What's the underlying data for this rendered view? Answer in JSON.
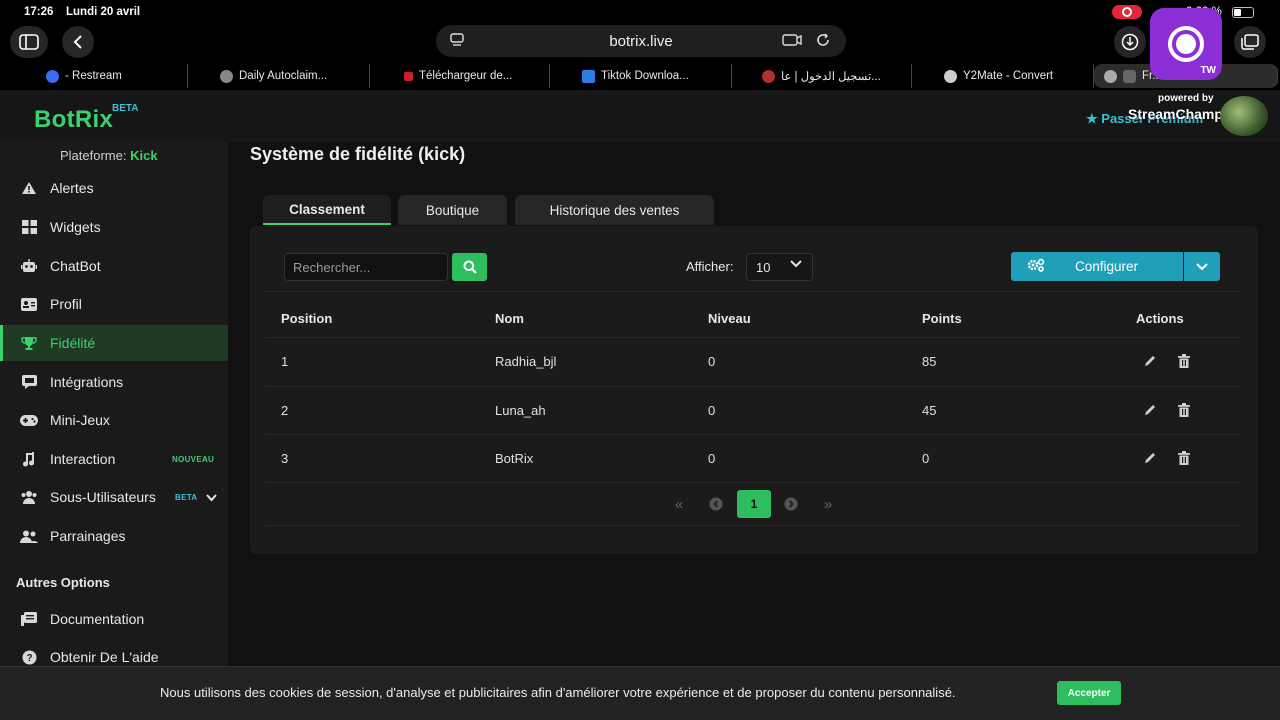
{
  "status": {
    "time": "17:26",
    "date": "Lundi 20 avril",
    "battery": "0 00 %"
  },
  "browser": {
    "url": "botrix.live",
    "tabs": [
      {
        "label": "- Restream",
        "color": "#3b6cf0"
      },
      {
        "label": "Daily Autoclaim...",
        "color": "#888888"
      },
      {
        "label": "Téléchargeur de...",
        "color": "#d01c2c"
      },
      {
        "label": "Tiktok Downloa...",
        "color": "#2a7de1"
      },
      {
        "label": "تسجيل الدخول | عا...",
        "color": "#b03030"
      },
      {
        "label": "Y2Mate - Convert",
        "color": "#cccccc"
      },
      {
        "label": "Fr... ...eil...",
        "color": "#aaaaaa"
      }
    ]
  },
  "overlay": {
    "tag": "TW",
    "powered": "powered by",
    "name": "StreamChamp.app"
  },
  "header": {
    "logo": "BotRix",
    "beta": "BETA",
    "premium": "Passer Premium"
  },
  "sidebar": {
    "platform_label": "Plateforme:",
    "platform_value": "Kick",
    "items": [
      {
        "label": "Alertes",
        "icon": "alert-icon"
      },
      {
        "label": "Widgets",
        "icon": "widgets-icon"
      },
      {
        "label": "ChatBot",
        "icon": "robot-icon"
      },
      {
        "label": "Profil",
        "icon": "profile-icon"
      },
      {
        "label": "Fidélité",
        "icon": "trophy-icon"
      },
      {
        "label": "Intégrations",
        "icon": "integrations-icon"
      },
      {
        "label": "Mini-Jeux",
        "icon": "gamepad-icon"
      },
      {
        "label": "Interaction",
        "icon": "music-icon"
      },
      {
        "label": "Sous-Utilisateurs",
        "icon": "users-icon"
      },
      {
        "label": "Parrainages",
        "icon": "referral-icon"
      }
    ],
    "badge_new": "NOUVEAU",
    "badge_beta": "BETA",
    "section": "Autres Options",
    "other": [
      {
        "label": "Documentation",
        "icon": "docs-icon"
      },
      {
        "label": "Obtenir De L'aide",
        "icon": "help-icon"
      }
    ]
  },
  "main": {
    "title": "Système de fidélité (kick)",
    "tabs": [
      "Classement",
      "Boutique",
      "Historique des ventes"
    ],
    "search_placeholder": "Rechercher...",
    "show_label": "Afficher:",
    "show_value": "10",
    "configure": "Configurer",
    "columns": [
      "Position",
      "Nom",
      "Niveau",
      "Points",
      "Actions"
    ],
    "rows": [
      {
        "position": "1",
        "name": "Radhia_bjl",
        "level": "0",
        "points": "85"
      },
      {
        "position": "2",
        "name": "Luna_ah",
        "level": "0",
        "points": "45"
      },
      {
        "position": "3",
        "name": "BotRix",
        "level": "0",
        "points": "0"
      }
    ],
    "pagination": {
      "first": "«",
      "prev": "‹",
      "current": "1",
      "next": "›",
      "last": "»"
    }
  },
  "cookie": {
    "text": "Nous utilisons des cookies de session, d'analyse et publicitaires afin d'améliorer votre expérience et de proposer du contenu personnalisé.",
    "accept": "Accepter"
  },
  "colors": {
    "accent": "#3bd16f",
    "info": "#1fa0b8",
    "highlight": "#3bbfd6"
  }
}
